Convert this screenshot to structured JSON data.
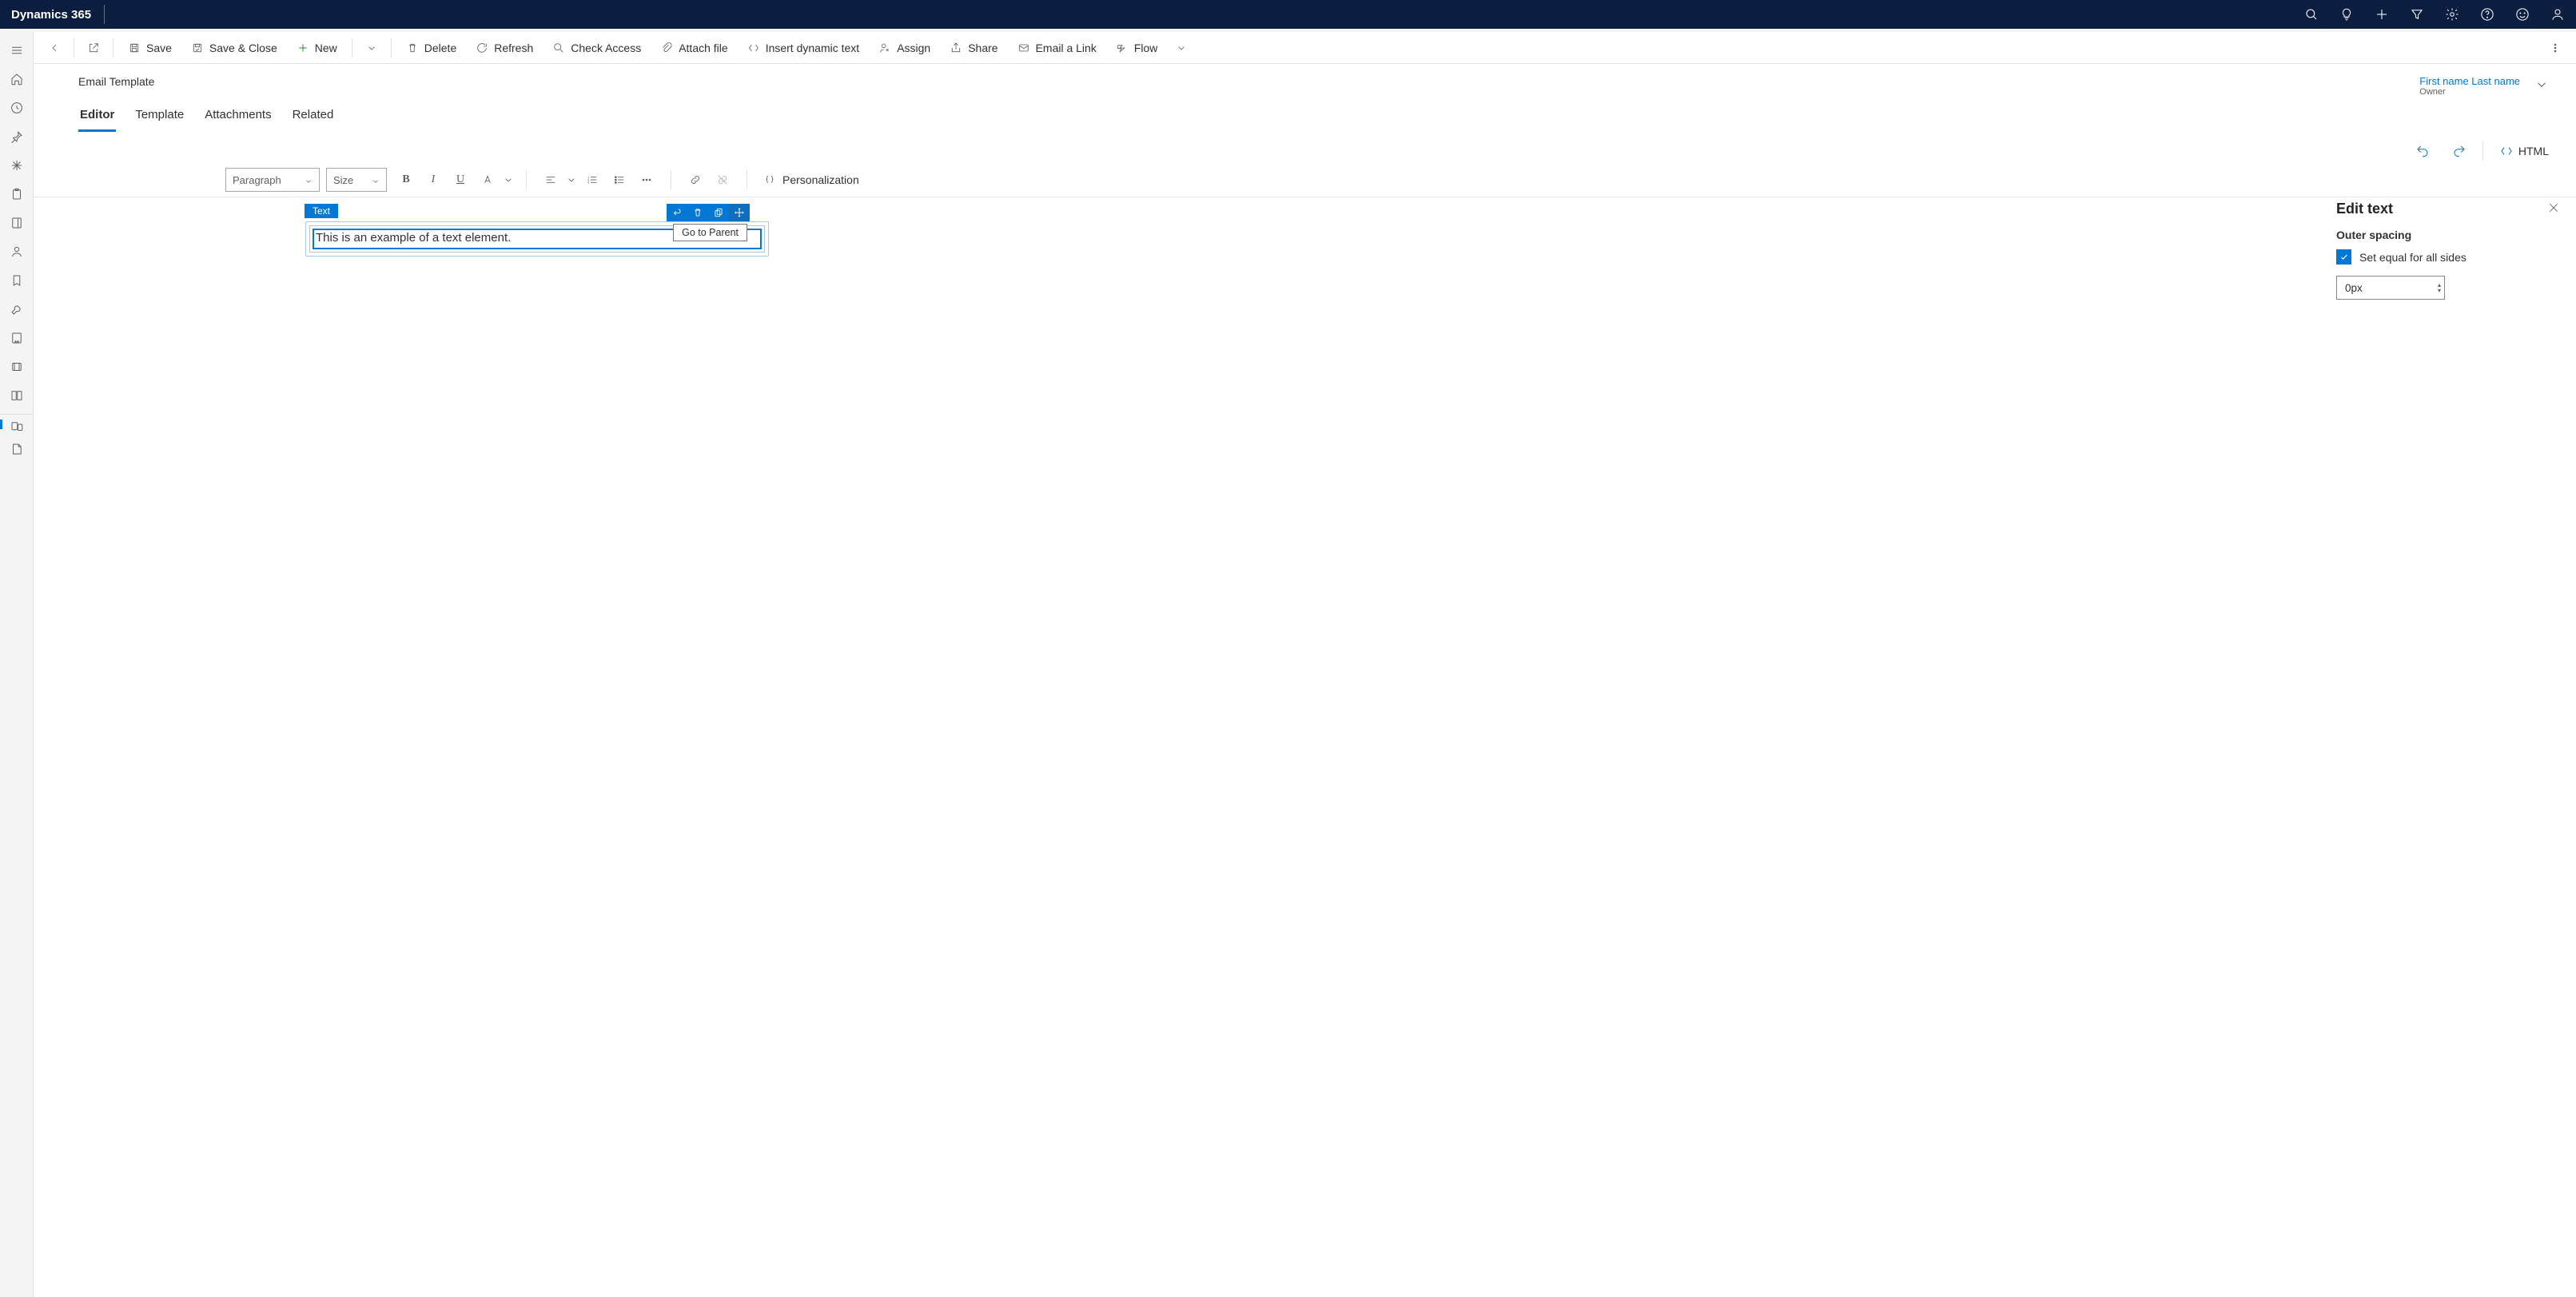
{
  "brand": "Dynamics 365",
  "cmd": {
    "save": "Save",
    "saveClose": "Save & Close",
    "new": "New",
    "delete": "Delete",
    "refresh": "Refresh",
    "checkAccess": "Check Access",
    "attach": "Attach file",
    "dynamic": "Insert dynamic text",
    "assign": "Assign",
    "share": "Share",
    "emailLink": "Email a Link",
    "flow": "Flow"
  },
  "record": {
    "title": "Email Template",
    "ownerName": "First name Last name",
    "ownerLabel": "Owner"
  },
  "tabs": {
    "editor": "Editor",
    "template": "Template",
    "attachments": "Attachments",
    "related": "Related"
  },
  "toolrow": {
    "html": "HTML"
  },
  "fmt": {
    "paragraph": "Paragraph",
    "size": "Size",
    "personalization": "Personalization"
  },
  "canvas": {
    "tag": "Text",
    "text": "This is an example of a text element.",
    "tooltip": "Go to Parent"
  },
  "panel": {
    "title": "Edit text",
    "section": "Outer spacing",
    "checkbox": "Set equal for all sides",
    "value": "0px"
  }
}
